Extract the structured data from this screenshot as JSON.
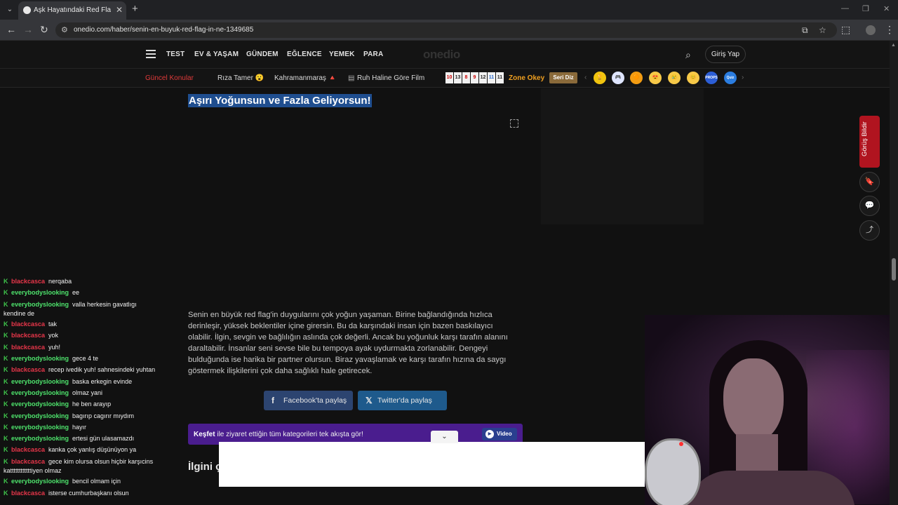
{
  "browser": {
    "tab_title": "Aşk Hayatındaki Red Flag'ini Sö",
    "tab_close": "✕",
    "new_tab": "+",
    "url": "onedio.com/haber/senin-en-buyuk-red-flag-in-ne-1349685",
    "window_controls": [
      "—",
      "❐",
      "✕"
    ]
  },
  "site": {
    "logo": "onedio",
    "nav": [
      "TEST",
      "EV & YAŞAM",
      "GÜNDEM",
      "EĞLENCE",
      "YEMEK",
      "PARA"
    ],
    "login": "Giriş Yap",
    "topics_title": "Güncel Konular",
    "topics": [
      "Rıza Tamer 😮",
      "Kahramanmaraş 🔺",
      "Ruh Haline Göre Film"
    ],
    "number_tiles": [
      "10",
      "13",
      "8",
      "9",
      "12",
      "11",
      "11"
    ],
    "zone_okey": "Zone Okey",
    "seri_diz": "Seri Diz",
    "game_icons": [
      "🏆",
      "🎮",
      "🟠",
      "😍",
      "😢",
      "😊",
      "PROPS",
      "Quiz"
    ]
  },
  "article": {
    "title": "Aşırı Yoğunsun ve Fazla Geliyorsun!",
    "body": "Senin en büyük red flag'in duygularını çok yoğun yaşaman. Birine bağlandığında hızlıca derinleşir, yüksek beklentiler içine girersin. Bu da karşındaki insan için bazen baskılayıcı olabilir. İlgin, sevgin ve bağlılığın aslında çok değerli. Ancak bu yoğunluk karşı tarafın alanını daraltabilir. İnsanlar seni sevse bile bu tempoya ayak uydurmakta zorlanabilir. Dengeyi bulduğunda ise harika bir partner olursun. Biraz yavaşlamak ve karşı tarafın hızına da saygı göstermek ilişkilerini çok daha sağlıklı hale getirecek.",
    "share_facebook": "Facebook'ta paylaş",
    "share_twitter": "Twitter'da paylaş",
    "discover_bold": "Keşfet",
    "discover_rest": " ile ziyaret ettiğin tüm kategorileri tek akışta gör!",
    "discover_video": "Video",
    "related_heading": "İlgini ç"
  },
  "rail": {
    "report": "Görüş Bildir"
  },
  "chat": [
    {
      "user": "blackcasca",
      "color": "red",
      "text": "nerqaba",
      "lines": 1
    },
    {
      "user": "everybodyslooking",
      "color": "green",
      "text": "ee",
      "lines": 1
    },
    {
      "user": "everybodyslooking",
      "color": "green",
      "text": "valla herkesin gavatlıgı",
      "cont": "kendine de",
      "lines": 2
    },
    {
      "user": "blackcasca",
      "color": "red",
      "text": "tak",
      "lines": 1
    },
    {
      "user": "blackcasca",
      "color": "red",
      "text": "yok",
      "lines": 1
    },
    {
      "user": "blackcasca",
      "color": "red",
      "text": "yuh!",
      "lines": 1
    },
    {
      "user": "everybodyslooking",
      "color": "green",
      "text": "gece 4 te",
      "lines": 1
    },
    {
      "user": "blackcasca",
      "color": "red",
      "text": "recep ivedik yuh! sahnesindeki yuhtan",
      "lines": 1
    },
    {
      "user": "everybodyslooking",
      "color": "green",
      "text": "baska erkegin evinde",
      "lines": 1
    },
    {
      "user": "everybodyslooking",
      "color": "green",
      "text": "olmaz yani",
      "lines": 1
    },
    {
      "user": "everybodyslooking",
      "color": "green",
      "text": "he ben arayıp",
      "lines": 1
    },
    {
      "user": "everybodyslooking",
      "color": "green",
      "text": "bagırıp cagırır mıydım",
      "lines": 1
    },
    {
      "user": "everybodyslooking",
      "color": "green",
      "text": "hayır",
      "lines": 1
    },
    {
      "user": "everybodyslooking",
      "color": "green",
      "text": "ertesi gün ulasamazdı",
      "lines": 1
    },
    {
      "user": "blackcasca",
      "color": "red",
      "text": "kanka çok yanlış düşünüyon ya",
      "lines": 1
    },
    {
      "user": "blackcasca",
      "color": "red",
      "text": "gece kim olursa olsun hiçbir karşıcins",
      "cont": "kattttttttttttiyen olmaz",
      "lines": 2
    },
    {
      "user": "everybodyslooking",
      "color": "green",
      "text": "bencil olmam için",
      "lines": 1
    },
    {
      "user": "blackcasca",
      "color": "red",
      "text": "isterse cumhurbaşkanı olsun",
      "lines": 1
    }
  ]
}
